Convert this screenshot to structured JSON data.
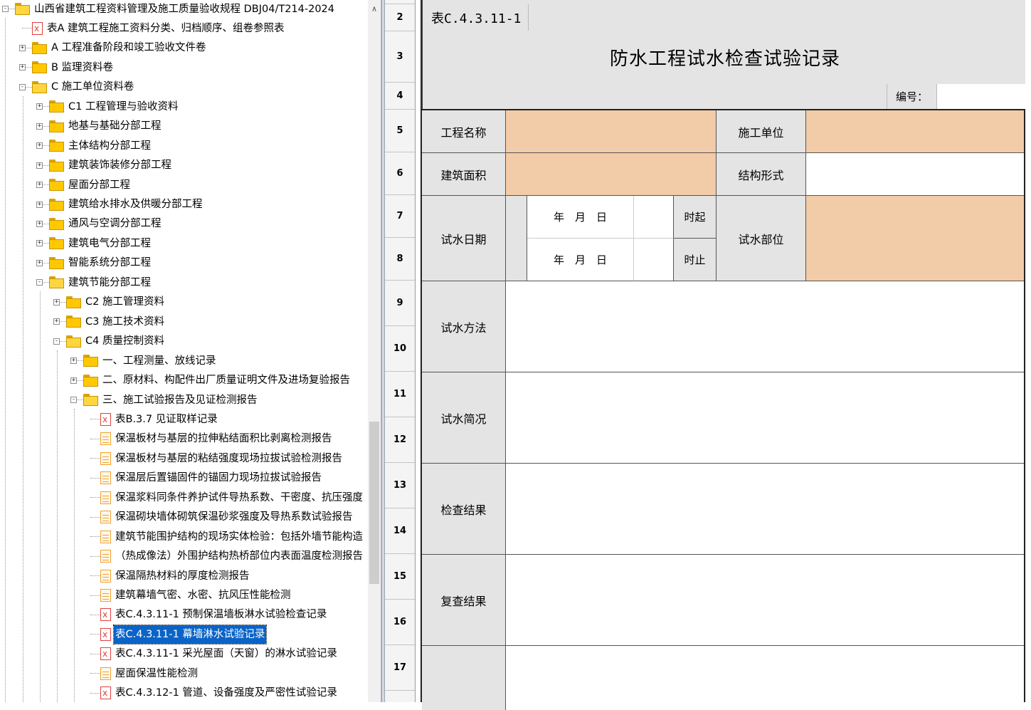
{
  "tree": {
    "root_label": "山西省建筑工程资料管理及施工质量验收规程 DBJ04/T214-2024",
    "nodes": [
      {
        "label": "表A 建筑工程施工资料分类、归档顺序、组卷参照表"
      },
      {
        "label": "A 工程准备阶段和竣工验收文件卷"
      },
      {
        "label": "B 监理资料卷"
      },
      {
        "label": "C 施工单位资料卷"
      },
      {
        "label": "C1 工程管理与验收资料"
      },
      {
        "label": "地基与基础分部工程"
      },
      {
        "label": "主体结构分部工程"
      },
      {
        "label": "建筑装饰装修分部工程"
      },
      {
        "label": "屋面分部工程"
      },
      {
        "label": "建筑给水排水及供暖分部工程"
      },
      {
        "label": "通风与空调分部工程"
      },
      {
        "label": "建筑电气分部工程"
      },
      {
        "label": "智能系统分部工程"
      },
      {
        "label": "建筑节能分部工程"
      },
      {
        "label": "C2 施工管理资料"
      },
      {
        "label": "C3 施工技术资料"
      },
      {
        "label": "C4 质量控制资料"
      },
      {
        "label": "一、工程测量、放线记录"
      },
      {
        "label": "二、原材料、构配件出厂质量证明文件及进场复验报告"
      },
      {
        "label": "三、施工试验报告及见证检测报告"
      },
      {
        "label": "表B.3.7 见证取样记录"
      },
      {
        "label": "保温板材与基层的拉伸粘结面积比剥离检测报告"
      },
      {
        "label": "保温板材与基层的粘结强度现场拉拔试验检测报告"
      },
      {
        "label": "保温层后置锚固件的锚固力现场拉拔试验报告"
      },
      {
        "label": "保温浆料同条件养护试件导热系数、干密度、抗压强度"
      },
      {
        "label": "保温砌块墙体砌筑保温砂浆强度及导热系数试验报告"
      },
      {
        "label": "建筑节能围护结构的现场实体检验：包括外墙节能构造"
      },
      {
        "label": "（热成像法）外围护结构热桥部位内表面温度检测报告"
      },
      {
        "label": "保温隔热材料的厚度检测报告"
      },
      {
        "label": "建筑幕墙气密、水密、抗风压性能检测"
      },
      {
        "label": "表C.4.3.11-1 预制保温墙板淋水试验检查记录"
      },
      {
        "label": "表C.4.3.11-1 幕墙淋水试验记录"
      },
      {
        "label": "表C.4.3.11-1 采光屋面（天窗）的淋水试验记录"
      },
      {
        "label": "屋面保温性能检测"
      },
      {
        "label": "表C.4.3.12-1 管道、设备强度及严密性试验记录"
      }
    ]
  },
  "rows": [
    "2",
    "3",
    "4",
    "5",
    "6",
    "7",
    "8",
    "9",
    "10",
    "11",
    "12",
    "13",
    "14",
    "15",
    "16",
    "17"
  ],
  "form": {
    "code": "表C.4.3.11-1",
    "title": "防水工程试水检查试验记录",
    "number_label": "编号：",
    "project_name_label": "工程名称",
    "contractor_label": "施工单位",
    "area_label": "建筑面积",
    "structure_label": "结构形式",
    "test_date_label": "试水日期",
    "date_start": "年　月　日",
    "date_end": "年　月　日",
    "time_start": "时起",
    "time_end": "时止",
    "test_location_label": "试水部位",
    "test_method_label": "试水方法",
    "test_summary_label": "试水简况",
    "inspection_result_label": "检查结果",
    "recheck_result_label": "复查结果"
  },
  "colors": {
    "input_fill": "#f2cba8",
    "label_fill": "#e4e4e4",
    "selection": "#0a64c8"
  }
}
